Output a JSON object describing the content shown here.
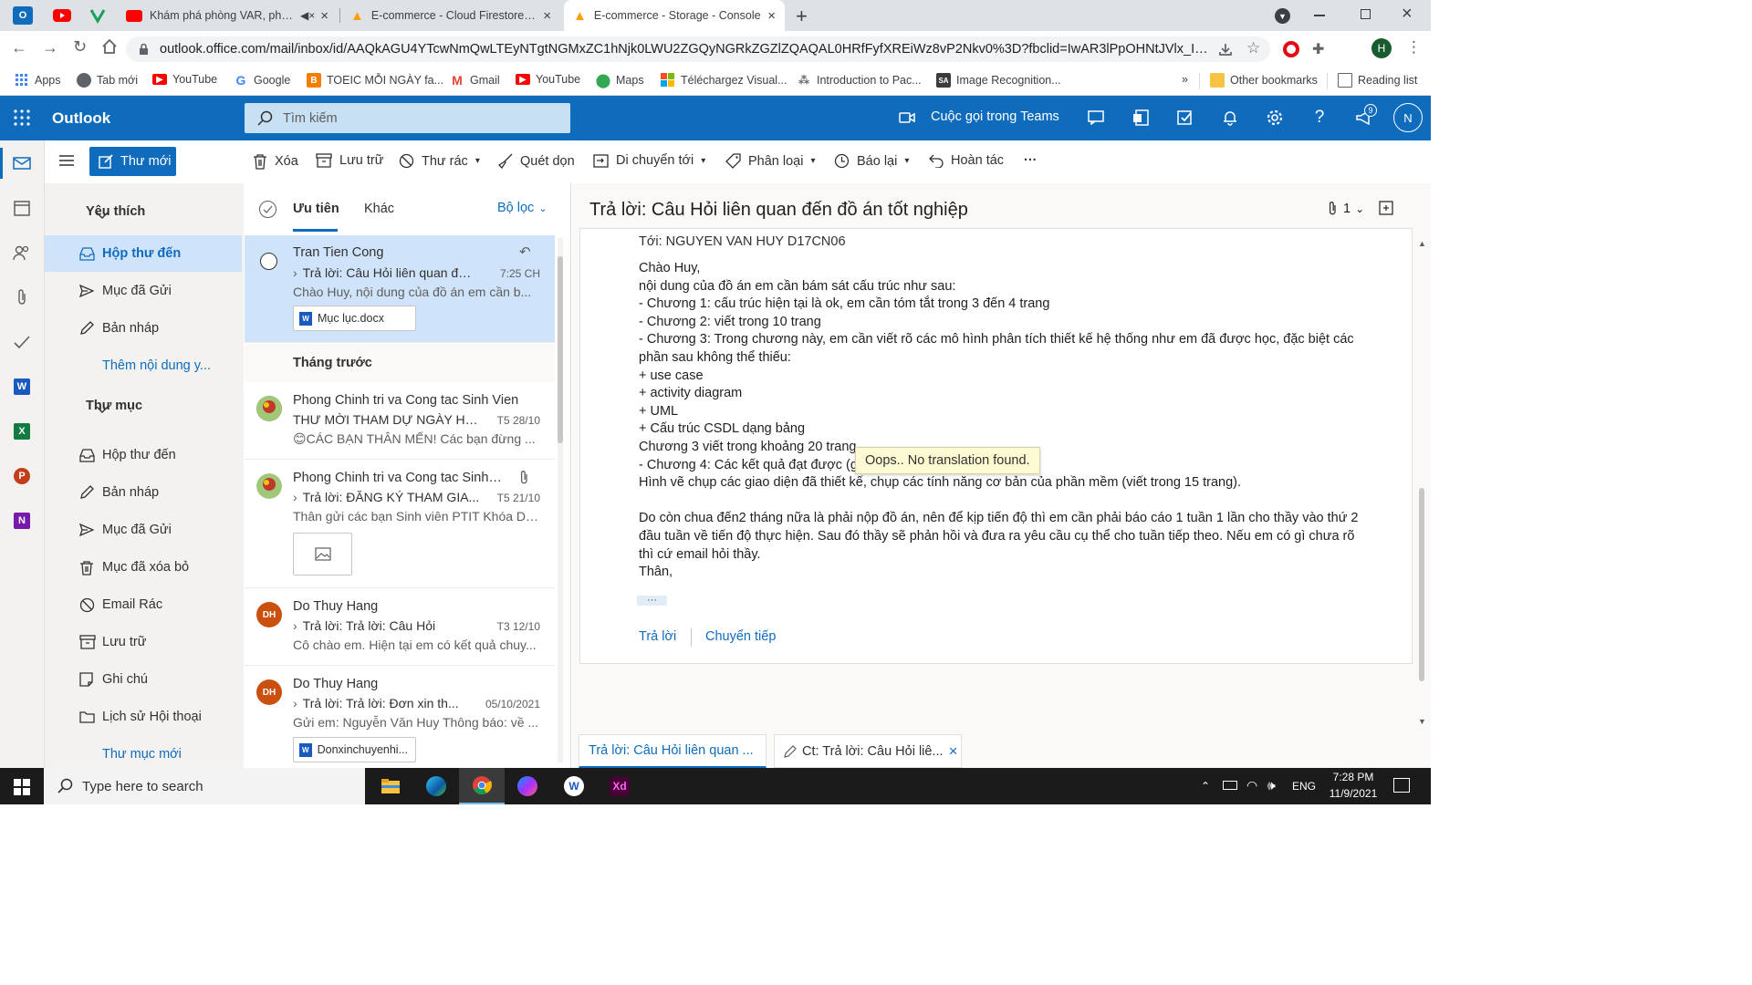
{
  "browser": {
    "tabs": [
      {
        "title": "Khám phá phòng VAR, phòng",
        "favicon": "youtube-icon"
      },
      {
        "title": "E-commerce - Cloud Firestore - C",
        "favicon": "firebase-icon"
      },
      {
        "title": "E-commerce - Storage - Console",
        "favicon": "firebase-icon"
      }
    ],
    "url": "outlook.office.com/mail/inbox/id/AAQkAGU4YTcwNmQwLTEyNTgtNGMxZC1hNjk0LWU2ZGQyNGRkZGZlZQAQAL0HRfFyfXREiWz8vP2Nkv0%3D?fbclid=IwAR3lPpOHNtJVlx_ILvaKSrp...",
    "profile_initial": "H",
    "bookmarks": [
      {
        "label": "Apps",
        "icon": "apps-grid-icon"
      },
      {
        "label": "Tab mới",
        "icon": "globe-icon"
      },
      {
        "label": "YouTube",
        "icon": "youtube-icon"
      },
      {
        "label": "Google",
        "icon": "google-icon"
      },
      {
        "label": "TOEIC MỖI NGÀY fa...",
        "icon": "blogger-icon"
      },
      {
        "label": "Gmail",
        "icon": "gmail-icon"
      },
      {
        "label": "YouTube",
        "icon": "youtube-icon"
      },
      {
        "label": "Maps",
        "icon": "maps-pin-icon"
      },
      {
        "label": "Téléchargez Visual...",
        "icon": "microsoft-icon"
      },
      {
        "label": "Introduction to Pac...",
        "icon": "site-icon"
      },
      {
        "label": "Image Recognition...",
        "icon": "sa-icon"
      }
    ],
    "more_bookmarks": "»",
    "other_bookmarks": "Other bookmarks",
    "reading_list": "Reading list"
  },
  "outlook": {
    "app_name": "Outlook",
    "search_placeholder": "Tìm kiếm",
    "teams_call": "Cuộc gọi trong Teams",
    "notification_count": "9",
    "user_initial": "N",
    "new_mail": "Thư mới",
    "commands": {
      "delete": "Xóa",
      "archive": "Lưu trữ",
      "junk": "Thư rác",
      "sweep": "Quét dọn",
      "move_to": "Di chuyển tới",
      "categorize": "Phân loại",
      "snooze": "Báo lại",
      "undo": "Hoàn tác",
      "more": "···"
    },
    "folders": {
      "favorites_header": "Yêu thích",
      "favorites": [
        {
          "label": "Hộp thư đến",
          "icon": "inbox-icon"
        },
        {
          "label": "Mục đã Gửi",
          "icon": "send-icon"
        },
        {
          "label": "Bản nháp",
          "icon": "pencil-icon"
        }
      ],
      "add_favorite": "Thêm nội dung y...",
      "folders_header": "Thư mục",
      "items": [
        {
          "label": "Hộp thư đến",
          "icon": "inbox-icon"
        },
        {
          "label": "Bản nháp",
          "icon": "pencil-icon"
        },
        {
          "label": "Mục đã Gửi",
          "icon": "send-icon"
        },
        {
          "label": "Mục đã xóa bỏ",
          "icon": "trash-icon"
        },
        {
          "label": "Email Rác",
          "icon": "block-icon"
        },
        {
          "label": "Lưu trữ",
          "icon": "archive-icon"
        },
        {
          "label": "Ghi chú",
          "icon": "note-icon"
        },
        {
          "label": "Lịch sử Hội thoại",
          "icon": "folder-icon"
        }
      ],
      "new_folder": "Thư mục mới"
    },
    "list": {
      "tab_focused": "Ưu tiên",
      "tab_other": "Khác",
      "filter": "Bộ lọc",
      "group_last_month": "Tháng trước",
      "messages": [
        {
          "from": "Tran Tien Cong",
          "subject": "Trả lời: Câu Hỏi liên quan đế...",
          "date": "7:25 CH",
          "preview": "Chào Huy, nội dung của đồ án em cần b...",
          "attachment": "Mục lục.docx"
        },
        {
          "from": "Phong Chinh tri va Cong tac Sinh Vien",
          "subject": "THƯ MỜI THAM DỰ NGÀY HỘ...",
          "date": "T5 28/10",
          "preview": "😊CÁC BẠN THÂN MẾN! Các bạn đừng ..."
        },
        {
          "from": "Phong Chinh tri va Cong tac Sinh ...",
          "subject": "Trả lời: ĐĂNG KÝ THAM GIA...",
          "date": "T5 21/10",
          "preview": "Thân gửi các bạn Sinh viên PTIT Khóa D1..."
        },
        {
          "from": "Do Thuy Hang",
          "subject": "Trả lời: Trả lời: Câu Hỏi",
          "date": "T3 12/10",
          "preview": "Cô chào em. Hiện tại em có kết quả chuy...",
          "initials": "DH"
        },
        {
          "from": "Do Thuy Hang",
          "subject": "Trả lời: Trả lời: Đơn xin th...",
          "date": "05/10/2021",
          "preview": "Gửi em: Nguyễn Văn Huy Thông báo: về ...",
          "initials": "DH",
          "attachment": "Donxinchuyenhi..."
        }
      ]
    },
    "reading": {
      "subject": "Trả lời: Câu Hỏi liên quan đến đồ án tốt nghiệp",
      "attachment_count": "1",
      "to": "Tới:  NGUYEN VAN HUY D17CN06",
      "body": [
        "Chào Huy,",
        "nội dung của đồ án em cần bám sát cấu trúc như sau:",
        "- Chương 1: cấu trúc hiện tại là ok, em cần tóm tắt trong 3 đến 4 trang",
        "- Chương 2: viết trong 10 trang",
        "- Chương 3: Trong chương này, em cần viết rõ các mô hình phân tích thiết kế hệ thống như em đã được học, đặc biệt các",
        "phần sau không thể thiếu:",
        "+ use case",
        "+ activity diagram",
        "+ UML",
        "+ Cấu trúc CSDL dạng bảng",
        "Chương 3 viết trong khoảng 20 trang",
        "- Chương 4: Các kết quả đạt được (g",
        "Hình vẽ chụp các giao diện đã thiết kế, chụp các tính năng cơ bản của phần mềm  (viết trong 15 trang).",
        "",
        "Do còn chua đến2 tháng nữa là phải nộp đồ án, nên để kịp tiến độ thì em cần phải báo cáo 1 tuần 1 lần cho thầy vào thứ 2",
        "đầu tuần về tiến độ thực hiện. Sau đó thầy sẽ phản hồi và đưa ra yêu cầu cụ thể cho tuần tiếp theo. Nếu em có gì chưa rõ",
        "thì cứ email hỏi thầy.",
        "Thân,"
      ],
      "tooltip": "Oops.. No translation found.",
      "ellipsis": "···",
      "reply": "Trả lời",
      "forward": "Chuyển tiếp"
    },
    "drafts": [
      {
        "label": "Trả lời: Câu Hỏi liên quan ..."
      },
      {
        "label": "Ct: Trả lời: Câu Hỏi liê..."
      }
    ]
  },
  "taskbar": {
    "search_placeholder": "Type here to search",
    "language": "ENG",
    "time": "7:28 PM",
    "date": "11/9/2021"
  },
  "colors": {
    "outlook_blue": "#0f6cbd",
    "selected": "#cfe4fa",
    "link": "#0f6cbd"
  }
}
